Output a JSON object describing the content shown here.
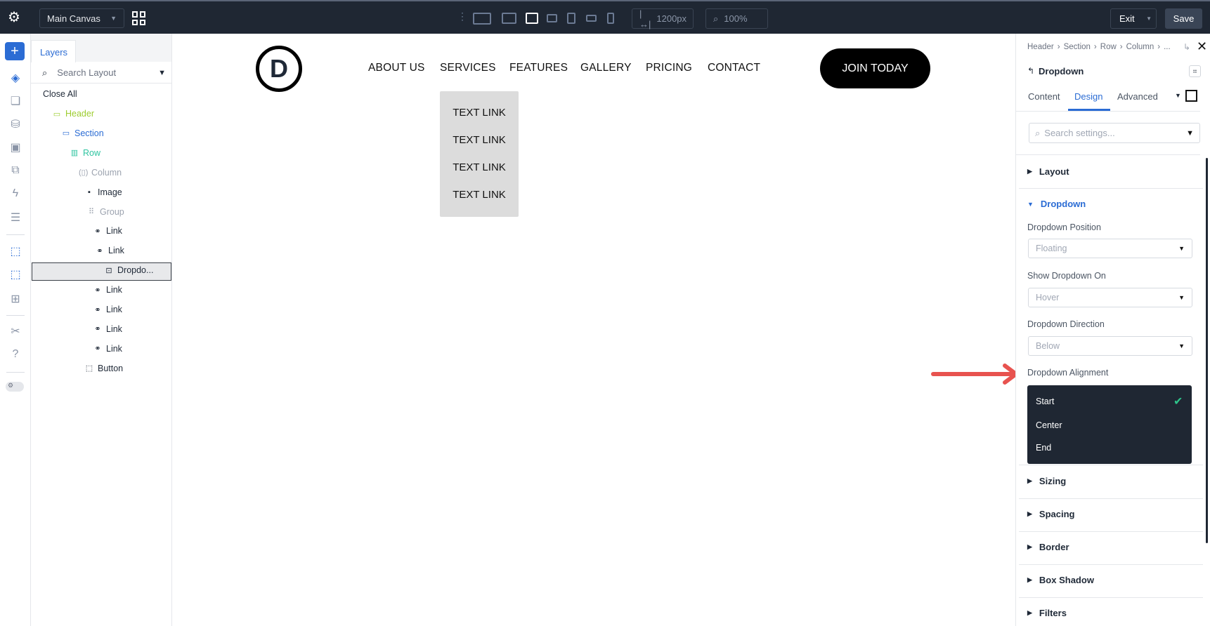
{
  "topbar": {
    "canvas_select": "Main Canvas",
    "width_value": "1200px",
    "zoom_value": "100%",
    "exit_label": "Exit",
    "save_label": "Save"
  },
  "layers": {
    "tab": "Layers",
    "search_placeholder": "Search Layout",
    "close_all": "Close All",
    "tree": [
      {
        "label": "Header",
        "icon": "header-icon"
      },
      {
        "label": "Section",
        "icon": "section-icon"
      },
      {
        "label": "Row",
        "icon": "row-icon"
      },
      {
        "label": "Column",
        "icon": "column-icon"
      },
      {
        "label": "Image",
        "icon": "image-icon"
      },
      {
        "label": "Group",
        "icon": "group-icon"
      },
      {
        "label": "Link",
        "icon": "link-icon"
      },
      {
        "label": "Link",
        "icon": "link-icon"
      },
      {
        "label": "Dropdo...",
        "icon": "dropdown-icon"
      },
      {
        "label": "Link",
        "icon": "link-icon"
      },
      {
        "label": "Link",
        "icon": "link-icon"
      },
      {
        "label": "Link",
        "icon": "link-icon"
      },
      {
        "label": "Link",
        "icon": "link-icon"
      },
      {
        "label": "Button",
        "icon": "button-icon"
      }
    ]
  },
  "canvas": {
    "logo_letter": "D",
    "nav": [
      "ABOUT US",
      "SERVICES",
      "FEATURES",
      "GALLERY",
      "PRICING",
      "CONTACT"
    ],
    "cta": "JOIN TODAY",
    "dropdown_links": [
      "TEXT LINK",
      "TEXT LINK",
      "TEXT LINK",
      "TEXT LINK"
    ]
  },
  "panel": {
    "breadcrumb": [
      "Header",
      "Section",
      "Row",
      "Column",
      "..."
    ],
    "title": "Dropdown",
    "tabs": [
      "Content",
      "Design",
      "Advanced"
    ],
    "search_placeholder": "Search settings...",
    "sections_top": [
      "Layout"
    ],
    "open_section": "Dropdown",
    "fields": [
      {
        "label": "Dropdown Position",
        "value": "Floating"
      },
      {
        "label": "Show Dropdown On",
        "value": "Hover"
      },
      {
        "label": "Dropdown Direction",
        "value": "Below"
      }
    ],
    "alignment_label": "Dropdown Alignment",
    "alignment_options": [
      "Start",
      "Center",
      "End"
    ],
    "alignment_selected": "Start",
    "sections_bottom": [
      "Sizing",
      "Spacing",
      "Border",
      "Box Shadow",
      "Filters"
    ]
  },
  "colors": {
    "accent": "#2b6cd4",
    "header": "#9ccc2e",
    "row": "#2ec4a0",
    "check": "#2ec48a",
    "arrow": "#e8534f"
  }
}
